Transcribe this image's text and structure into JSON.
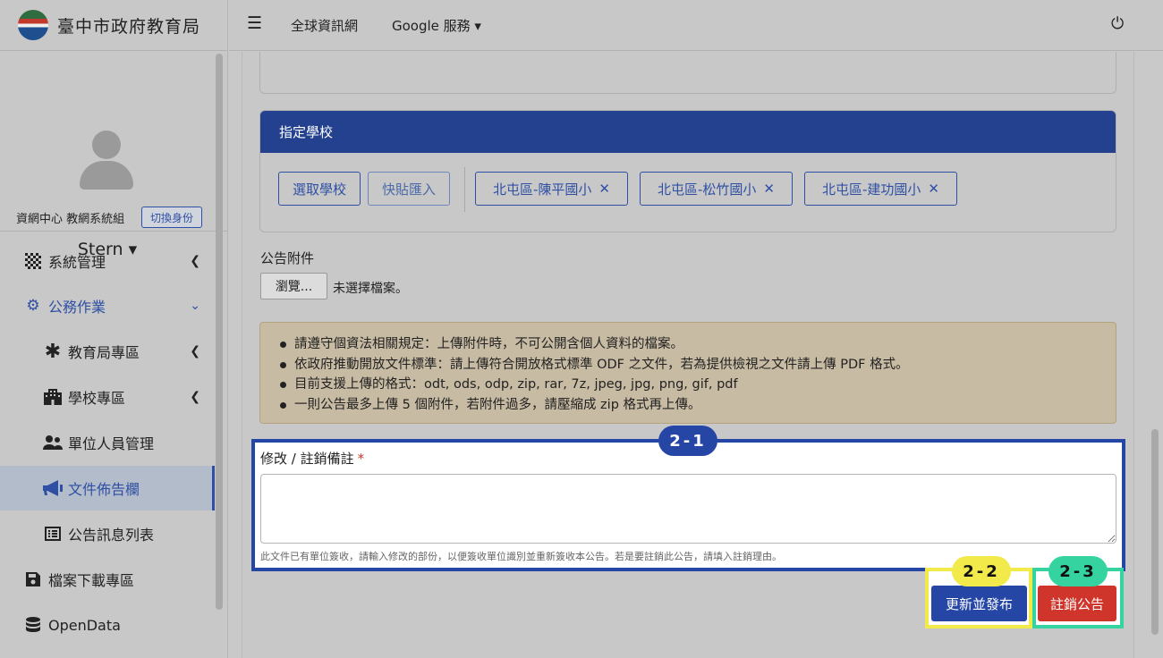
{
  "brand": {
    "name": "臺中市政府教育局"
  },
  "user": {
    "unit": "資網中心 教網系統組",
    "switch_label": "切換身份",
    "name": "Stern ▾"
  },
  "nav": {
    "system": "系統管理",
    "office": "公務作業",
    "edu_zone": "教育局專區",
    "school_zone": "學校專區",
    "staff": "單位人員管理",
    "doc_board": "文件佈告欄",
    "notice_list": "公告訊息列表",
    "download": "檔案下載專區",
    "opendata": "OpenData"
  },
  "topbar": {
    "menu_icon": "☰",
    "global": "全球資訊網",
    "google": "Google 服務 ▾",
    "power_icon": "⏻"
  },
  "school": {
    "header": "指定學校",
    "select_btn": "選取學校",
    "paste_btn": "快貼匯入",
    "tags": [
      "北屯區-陳平國小",
      "北屯區-松竹國小",
      "北屯區-建功國小"
    ],
    "remove_icon": "✕"
  },
  "attachment": {
    "label": "公告附件",
    "browse": "瀏覽...",
    "no_file": "未選擇檔案。"
  },
  "notice": {
    "lines": [
      "請遵守個資法相關規定：上傳附件時，不可公開含個人資料的檔案。",
      "依政府推動開放文件標準：請上傳符合開放格式標準 ODF 之文件，若為提供檢視之文件請上傳 PDF 格式。",
      "目前支援上傳的格式：odt, ods, odp, zip, rar, 7z, jpeg, jpg, png, gif, pdf",
      "一則公告最多上傳 5 個附件，若附件過多，請壓縮成 zip 格式再上傳。"
    ]
  },
  "memo": {
    "label": "修改 / 註銷備註",
    "required": "*",
    "help": "此文件已有單位簽收，請輸入修改的部份，以便簽收單位識別並重新簽收本公告。若是要註銷此公告，請填入註銷理由。"
  },
  "actions": {
    "update": "更新並發布",
    "cancel": "註銷公告"
  },
  "badges": {
    "b1": "2-1",
    "b2": "2-2",
    "b3": "2-3"
  },
  "colors": {
    "primary": "#2646a6",
    "danger": "#d0352b",
    "highlight_yellow": "#f2e94a",
    "highlight_green": "#35d3a0"
  }
}
